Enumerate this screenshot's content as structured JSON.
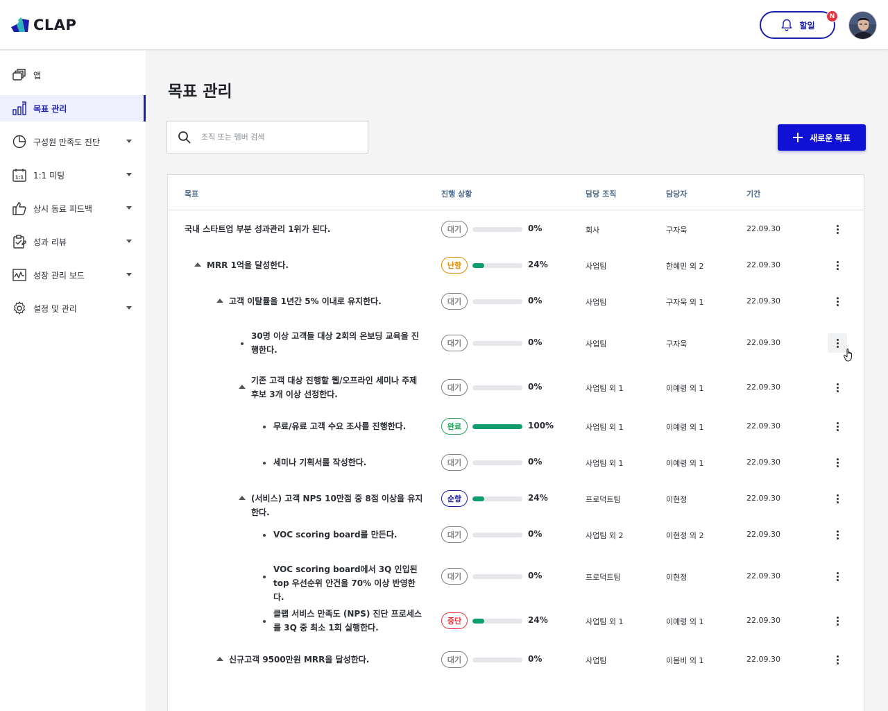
{
  "header": {
    "logo_text": "CLAP",
    "todo_label": "할일",
    "notification_badge": "N"
  },
  "colors": {
    "brand": "#1b1fa8",
    "primary_button": "#1111d6",
    "progress_fill": "#0f9d6e",
    "status_delayed": "#e08a00",
    "status_done": "#1fa654",
    "status_on_track": "#1b1fa8",
    "status_stopped": "#e5343e",
    "status_waiting": "#7d8187"
  },
  "sidebar": {
    "items": [
      {
        "label": "앱",
        "icon": "apps-icon",
        "expandable": false,
        "active": false
      },
      {
        "label": "목표 관리",
        "icon": "goal-chart-icon",
        "expandable": false,
        "active": true
      },
      {
        "label": "구성원 만족도 진단",
        "icon": "pie-chart-icon",
        "expandable": true,
        "active": false
      },
      {
        "label": "1:1 미팅",
        "icon": "calendar-icon",
        "expandable": true,
        "active": false
      },
      {
        "label": "상시 동료 피드백",
        "icon": "thumbs-up-icon",
        "expandable": true,
        "active": false
      },
      {
        "label": "성과 리뷰",
        "icon": "clipboard-icon",
        "expandable": true,
        "active": false
      },
      {
        "label": "성장 관리 보드",
        "icon": "growth-board-icon",
        "expandable": true,
        "active": false
      },
      {
        "label": "설정 및 관리",
        "icon": "gear-icon",
        "expandable": true,
        "active": false
      }
    ]
  },
  "main": {
    "title": "목표 관리",
    "search_placeholder": "조직 또는 멤버 검색",
    "new_goal_label": "새로운 목표"
  },
  "table": {
    "columns": [
      "목표",
      "진행 상황",
      "담당 조직",
      "담당자",
      "기간"
    ],
    "rows": [
      {
        "goal": "국내 스타트업 부분 성과관리 1위가 된다.",
        "level": 0,
        "marker": "none",
        "status": "대기",
        "status_key": "waiting",
        "progress": 0,
        "progress_label": "0%",
        "org": "회사",
        "owner": "구자욱",
        "period": "22.09.30"
      },
      {
        "goal": "MRR 1억을 달성한다.",
        "level": 1,
        "marker": "triangle",
        "status": "난항",
        "status_key": "delayed",
        "progress": 24,
        "progress_label": "24%",
        "org": "사업팀",
        "owner": "한혜민 외 2",
        "period": "22.09.30"
      },
      {
        "goal": "고객 이탈률을 1년간 5% 이내로 유지한다.",
        "level": 2,
        "marker": "triangle",
        "status": "대기",
        "status_key": "waiting",
        "progress": 0,
        "progress_label": "0%",
        "org": "사업팀",
        "owner": "구자욱 외 1",
        "period": "22.09.30"
      },
      {
        "goal": "30명 이상 고객들 대상 2회의 온보딩 교육을 진행한다.",
        "level": 3,
        "marker": "dot",
        "status": "대기",
        "status_key": "waiting",
        "progress": 0,
        "progress_label": "0%",
        "org": "사업팀",
        "owner": "구자욱",
        "period": "22.09.30"
      },
      {
        "goal": "기존 고객 대상 진행할 웹/오프라인 세미나 주제 후보 3개 이상 선정한다.",
        "level": 3,
        "marker": "triangle",
        "status": "대기",
        "status_key": "waiting",
        "progress": 0,
        "progress_label": "0%",
        "org": "사업팀 외 1",
        "owner": "이예령 외 1",
        "period": "22.09.30"
      },
      {
        "goal": "무료/유료 고객 수요 조사를 진행한다.",
        "level": 4,
        "marker": "dot",
        "status": "완료",
        "status_key": "done",
        "progress": 100,
        "progress_label": "100%",
        "org": "사업팀 외 1",
        "owner": "이예령 외 1",
        "period": "22.09.30"
      },
      {
        "goal": "세미나 기획서를 작성한다.",
        "level": 4,
        "marker": "dot",
        "status": "대기",
        "status_key": "waiting",
        "progress": 0,
        "progress_label": "0%",
        "org": "사업팀 외 1",
        "owner": "이예령 외 1",
        "period": "22.09.30"
      },
      {
        "goal": "(서비스) 고객 NPS 10만점 중 8점 이상을 유지한다.",
        "level": 3,
        "marker": "triangle",
        "status": "순항",
        "status_key": "on_track",
        "progress": 24,
        "progress_label": "24%",
        "org": "프로덕트팀",
        "owner": "이현정",
        "period": "22.09.30"
      },
      {
        "goal": "VOC scoring board를 만든다.",
        "level": 4,
        "marker": "dot",
        "status": "대기",
        "status_key": "waiting",
        "progress": 0,
        "progress_label": "0%",
        "org": "사업팀 외 2",
        "owner": "이현정 외 2",
        "period": "22.09.30"
      },
      {
        "goal": "VOC scoring board에서 3Q 인입된 top 우선순위 안건을 70% 이상 반영한다.",
        "level": 4,
        "marker": "dot",
        "status": "대기",
        "status_key": "waiting",
        "progress": 0,
        "progress_label": "0%",
        "org": "프로덕트팀",
        "owner": "이현정",
        "period": "22.09.30"
      },
      {
        "goal": "클랩 서비스 만족도 (NPS) 진단 프로세스를 3Q 중 최소 1회 실행한다.",
        "level": 4,
        "marker": "dot",
        "status": "중단",
        "status_key": "stopped",
        "progress": 24,
        "progress_label": "24%",
        "org": "사업팀 외 1",
        "owner": "이예령 외 1",
        "period": "22.09.30"
      },
      {
        "goal": "신규고객 9500만원 MRR을 달성한다.",
        "level": 2,
        "marker": "triangle",
        "status": "대기",
        "status_key": "waiting",
        "progress": 0,
        "progress_label": "0%",
        "org": "사업팀",
        "owner": "이봄비 외 1",
        "period": "22.09.30"
      }
    ]
  }
}
